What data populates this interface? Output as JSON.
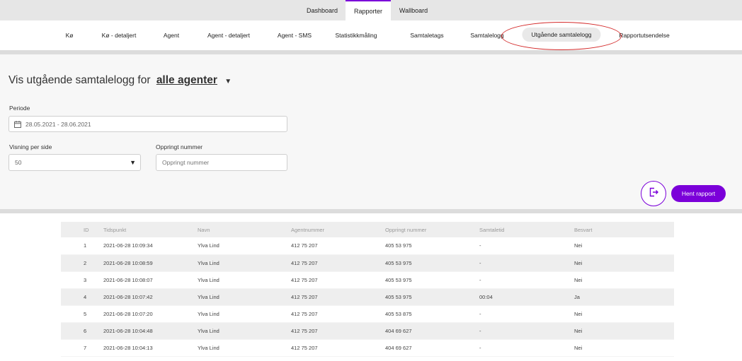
{
  "top_tabs": [
    {
      "label": "Dashboard",
      "active": false
    },
    {
      "label": "Rapporter",
      "active": true
    },
    {
      "label": "Wallboard",
      "active": false
    }
  ],
  "sub_nav": [
    {
      "label": "Kø"
    },
    {
      "label": "Kø - detaljert"
    },
    {
      "label": "Agent"
    },
    {
      "label": "Agent - detaljert"
    },
    {
      "label": "Agent - SMS"
    },
    {
      "label": "Statistikkmåling"
    },
    {
      "label": "Samtaletags"
    },
    {
      "label": "Samtalelogg"
    },
    {
      "label": "Utgående samtalelogg",
      "active": true
    },
    {
      "label": "Rapportutsendelse"
    }
  ],
  "heading": {
    "prefix": "Vis utgående samtalelogg for",
    "agents": "alle agenter"
  },
  "filters": {
    "period_label": "Periode",
    "period_value": "28.05.2021 - 28.06.2021",
    "per_page_label": "Visning per side",
    "per_page_value": "50",
    "number_label": "Oppringt nummer",
    "number_placeholder": "Oppringt nummer"
  },
  "actions": {
    "fetch_label": "Hent rapport",
    "export_icon": "export-icon"
  },
  "table": {
    "columns": [
      "ID",
      "Tidspunkt",
      "Navn",
      "Agentnummer",
      "Oppringt nummer",
      "Samtaletid",
      "Besvart"
    ],
    "rows": [
      [
        "1",
        "2021-06-28 10:09:34",
        "Ylva Lind",
        "412 75 207",
        "405 53 975",
        "-",
        "Nei"
      ],
      [
        "2",
        "2021-06-28 10:08:59",
        "Ylva Lind",
        "412 75 207",
        "405 53 975",
        "-",
        "Nei"
      ],
      [
        "3",
        "2021-06-28 10:08:07",
        "Ylva Lind",
        "412 75 207",
        "405 53 975",
        "-",
        "Nei"
      ],
      [
        "4",
        "2021-06-28 10:07:42",
        "Ylva Lind",
        "412 75 207",
        "405 53 975",
        "00:04",
        "Ja"
      ],
      [
        "5",
        "2021-06-28 10:07:20",
        "Ylva Lind",
        "412 75 207",
        "405 53 875",
        "-",
        "Nei"
      ],
      [
        "6",
        "2021-06-28 10:04:48",
        "Ylva Lind",
        "412 75 207",
        "404 69 627",
        "-",
        "Nei"
      ],
      [
        "7",
        "2021-06-28 10:04:13",
        "Ylva Lind",
        "412 75 207",
        "404 69 627",
        "-",
        "Nei"
      ]
    ]
  },
  "colors": {
    "accent": "#7b00d9",
    "annotation": "#d42a2a"
  }
}
